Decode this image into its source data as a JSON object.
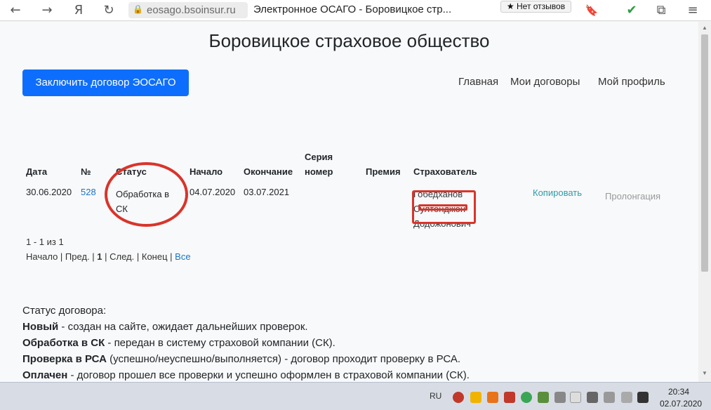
{
  "browser": {
    "back_icon": "←",
    "forward_icon": "→",
    "yandex_icon": "Я",
    "reload_icon": "↻",
    "lock_icon": "🔒",
    "url": "eosago.bsoinsur.ru",
    "tab_title": "Электронное ОСАГО - Боровицкое стр...",
    "reviews_button": "★ Нет отзывов",
    "bookmark_icon": "🔖",
    "shield_icon": "✔",
    "extension_icon": "⧉",
    "menu_icon": "≡"
  },
  "site": {
    "title": "Боровицкое страховое общество",
    "primary_button": "Заключить договор ЭОСАГО",
    "nav": [
      "Главная",
      "Мои договоры",
      "Мой профиль"
    ]
  },
  "table": {
    "headers": {
      "date": "Дата",
      "number": "№",
      "status": "Статус",
      "start": "Начало",
      "end": "Окончание",
      "series_line1": "Серия",
      "series_line2": "номер",
      "premium": "Премия",
      "insurer": "Страхователь"
    },
    "rows": [
      {
        "date": "30.06.2020",
        "number": "528",
        "status": "Обработка в СК",
        "start": "04.07.2020",
        "end": "03.07.2021",
        "series": "",
        "premium": "",
        "insurer": "Гобедханов Султонджон Додожонович",
        "copy": "Копировать",
        "prolong": "Пролонгация"
      }
    ]
  },
  "pager": {
    "info": "1 - 1 из 1",
    "first": "Начало",
    "prev": "Пред.",
    "current": "1",
    "next": "След.",
    "last": "Конец",
    "all": "Все",
    "sep": "|"
  },
  "legend": {
    "heading": "Статус договора:",
    "items": [
      {
        "term": "Новый",
        "extra": "",
        "desc": " - создан на сайте, ожидает дальнейших проверок."
      },
      {
        "term": "Обработка в СК",
        "extra": "",
        "desc": " - передан в систему страховой компании (СК)."
      },
      {
        "term": "Проверка в РСА",
        "extra": " (успешно/неуспешно/выполняется)",
        "desc": " - договор проходит проверку в РСА."
      },
      {
        "term": "Оплачен",
        "extra": "",
        "desc": " - договор прошел все проверки и успешно оформлен в страховой компании (СК)."
      }
    ]
  },
  "taskbar": {
    "lang": "RU",
    "time": "20:34",
    "date": "02.07.2020"
  },
  "colors": {
    "accent": "#0d6efd",
    "annotation": "#d9342b",
    "link": "#1a73c7"
  }
}
